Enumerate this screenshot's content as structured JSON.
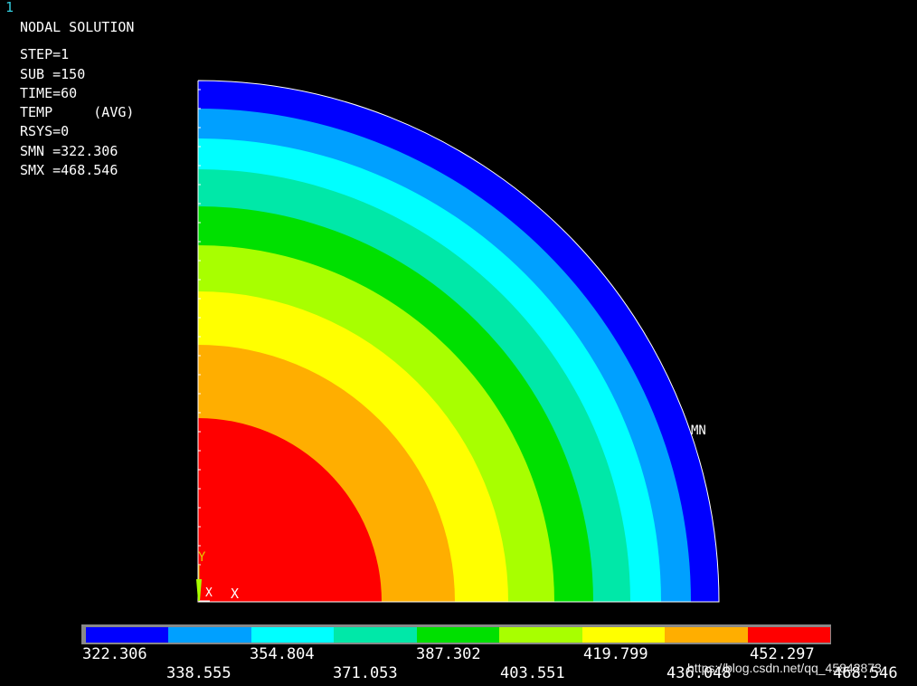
{
  "window_number": "1",
  "info": {
    "title": "NODAL SOLUTION",
    "lines": [
      "STEP=1",
      "SUB =150",
      "TIME=60",
      "TEMP     (AVG)",
      "RSYS=0",
      "SMN =322.306",
      "SMX =468.546"
    ]
  },
  "plot": {
    "min_label": "MN",
    "axis_y_label": "Y",
    "axis_x_label": "X",
    "axis_x_small": "X",
    "band_colors": [
      "#0000ff",
      "#00a0ff",
      "#00ffff",
      "#00e8a8",
      "#00e000",
      "#a8ff00",
      "#ffff00",
      "#ffae00",
      "#ff0000"
    ]
  },
  "legend": {
    "colors": [
      "#0000ff",
      "#00a0ff",
      "#00ffff",
      "#00e8a8",
      "#00e000",
      "#a8ff00",
      "#ffff00",
      "#ffae00",
      "#ff0000"
    ],
    "labels_top": [
      "322.306",
      "354.804",
      "387.302",
      "419.799",
      "452.297"
    ],
    "labels_bottom": [
      "338.555",
      "371.053",
      "403.551",
      "436.048",
      "468.546"
    ]
  },
  "watermark": "https://blog.csdn.net/qq_45842873"
}
